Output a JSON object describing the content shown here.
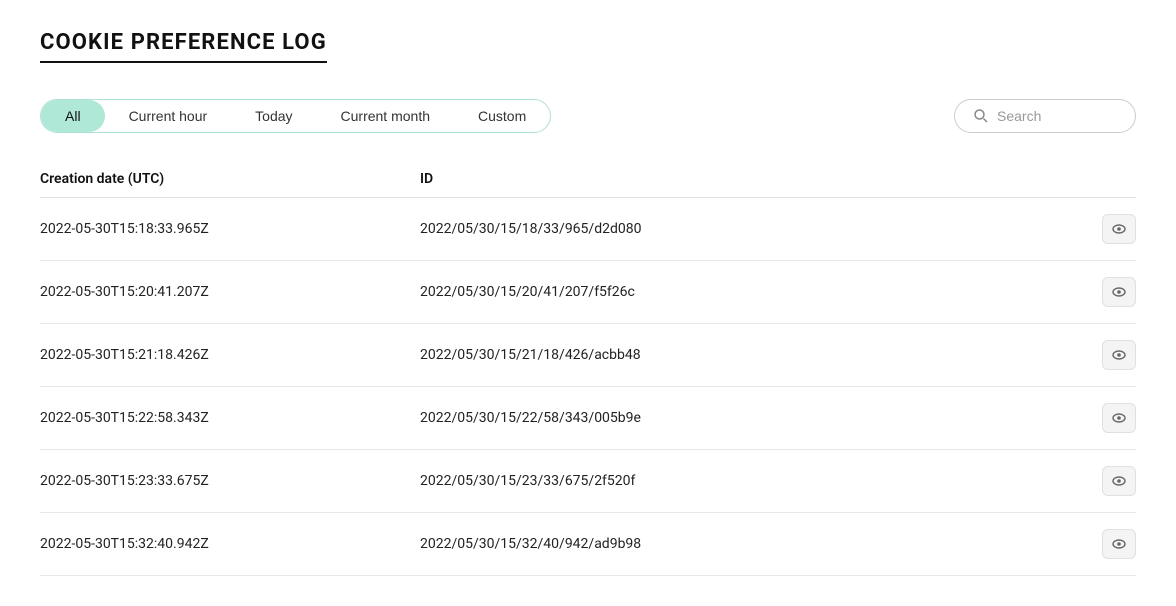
{
  "page": {
    "title": "COOKIE PREFERENCE LOG"
  },
  "toolbar": {
    "tabs": [
      {
        "id": "all",
        "label": "All",
        "active": true
      },
      {
        "id": "current-hour",
        "label": "Current hour",
        "active": false
      },
      {
        "id": "today",
        "label": "Today",
        "active": false
      },
      {
        "id": "current-month",
        "label": "Current month",
        "active": false
      },
      {
        "id": "custom",
        "label": "Custom",
        "active": false
      }
    ],
    "search": {
      "placeholder": "Search"
    }
  },
  "table": {
    "headers": {
      "date": "Creation date (UTC)",
      "id": "ID"
    },
    "rows": [
      {
        "date": "2022-05-30T15:18:33.965Z",
        "id": "2022/05/30/15/18/33/965/d2d080"
      },
      {
        "date": "2022-05-30T15:20:41.207Z",
        "id": "2022/05/30/15/20/41/207/f5f26c"
      },
      {
        "date": "2022-05-30T15:21:18.426Z",
        "id": "2022/05/30/15/21/18/426/acbb48"
      },
      {
        "date": "2022-05-30T15:22:58.343Z",
        "id": "2022/05/30/15/22/58/343/005b9e"
      },
      {
        "date": "2022-05-30T15:23:33.675Z",
        "id": "2022/05/30/15/23/33/675/2f520f"
      },
      {
        "date": "2022-05-30T15:32:40.942Z",
        "id": "2022/05/30/15/32/40/942/ad9b98"
      }
    ]
  }
}
